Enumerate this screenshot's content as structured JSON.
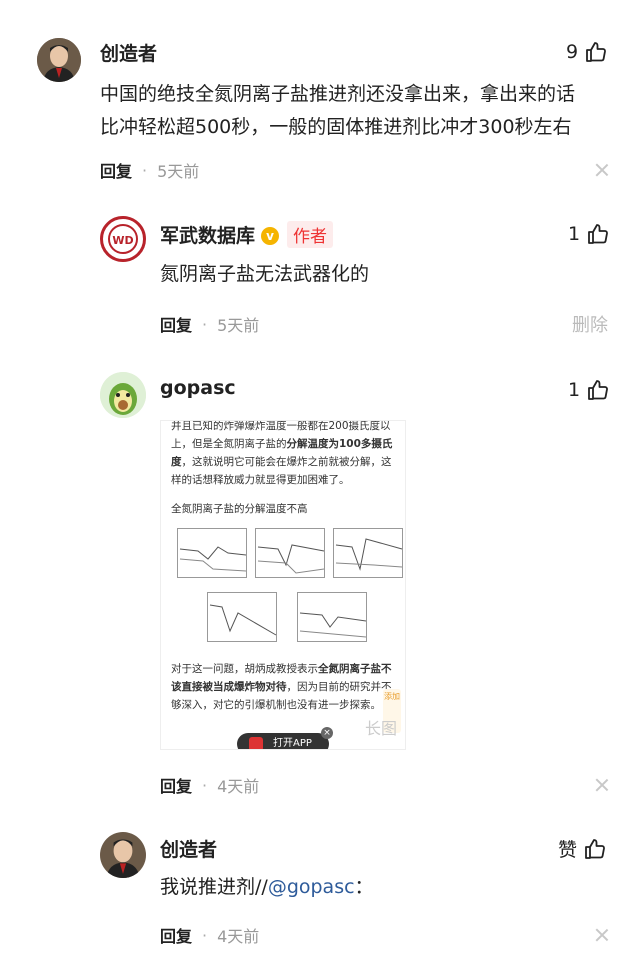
{
  "comments": [
    {
      "name": "创造者",
      "likes": "9",
      "text_line1": "中国的绝技全氮阴离子盐推进剂还没拿出来，拿出来的话",
      "text_line2": "比冲轻松超500秒，一般的固体推进剂比冲才300秒左右",
      "reply": "回复",
      "time": "5天前"
    },
    {
      "name": "军武数据库",
      "v_badge": "v",
      "author_tag": "作者",
      "avatar_text": "WD",
      "likes": "1",
      "text": "氮阴离子盐无法武器化的",
      "reply": "回复",
      "time": "5天前",
      "delete": "删除"
    },
    {
      "name": "gopasc",
      "likes": "1",
      "reply": "回复",
      "time": "4天前",
      "image": {
        "para1_plain_a": "并且已知的炸弹爆炸温度一般都在200摄氏度以上，但是全氮阴离子盐的",
        "para1_bold": "分解温度为100多摄氏度",
        "para1_plain_b": "，这就说明它可能会在爆炸之前就被分解，这样的话想释放威力就显得更加困难了。",
        "fig_title": "全氮阴离子盐的分解温度不高",
        "para2_plain_a": "对于这一问题，胡炳成教授表示",
        "para2_bold": "全氮阴离子盐不该直接被当成爆炸物对待",
        "para2_plain_b": "，因为目前的研究并不够深入，对它的引爆机制也没有进一步探索。",
        "open_app": "打开APP",
        "side_tool": "添加",
        "long_tag": "长图"
      }
    },
    {
      "name": "创造者",
      "likes": "赞",
      "text_plain": "我说推进剂//",
      "mention": "@gopasc",
      "text_tail": "：",
      "reply": "回复",
      "time": "4天前"
    }
  ],
  "colors": {
    "author_tag": "#ee3333",
    "mention": "#2e5b9a",
    "v_badge": "#f5b400"
  }
}
